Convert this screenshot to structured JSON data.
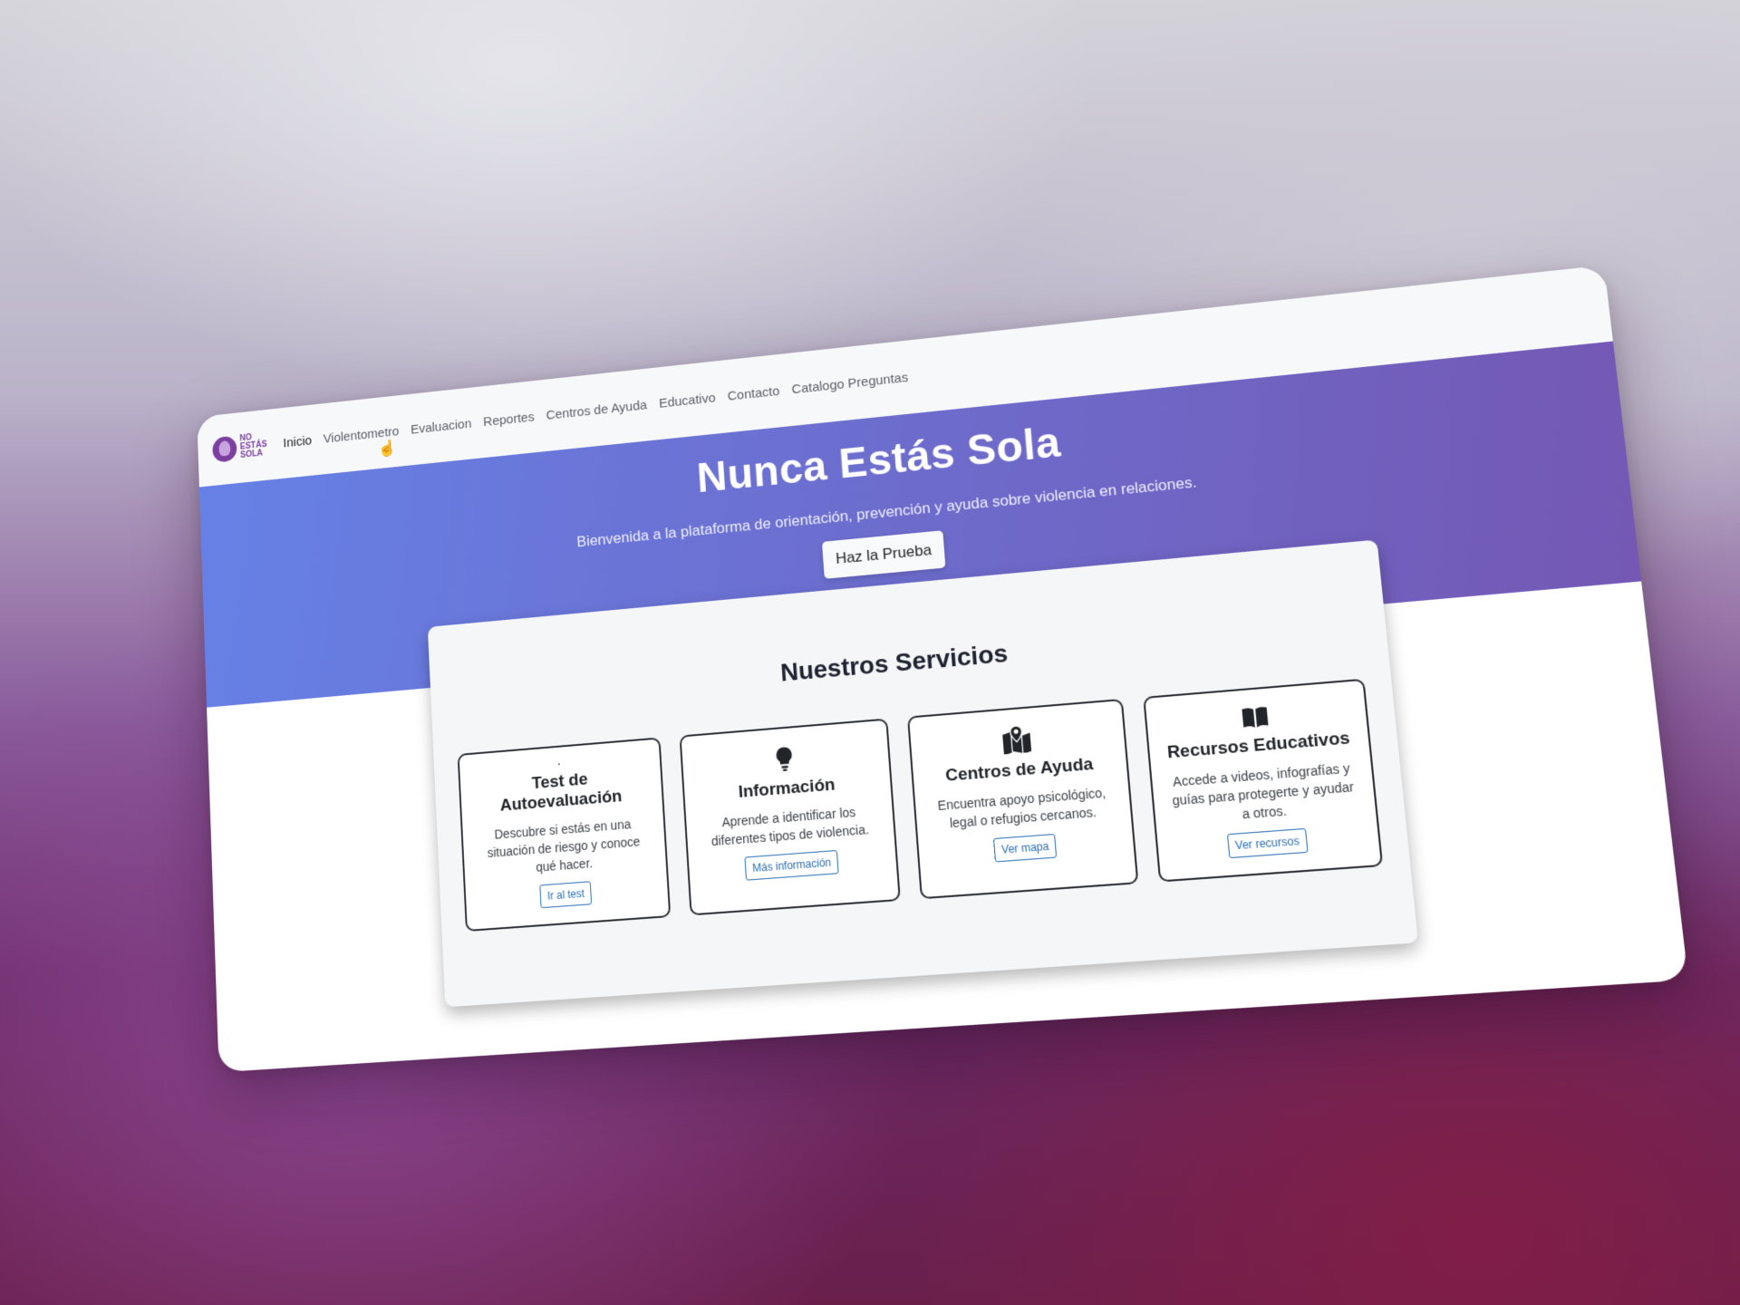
{
  "brand": {
    "logo_lines": [
      "NO",
      "ESTÁS",
      "SOLA"
    ],
    "logo_color": "#7b3fa0"
  },
  "nav": {
    "items": [
      {
        "label": "Inicio",
        "active": true
      },
      {
        "label": "Violentometro",
        "active": false
      },
      {
        "label": "Evaluacion",
        "active": false
      },
      {
        "label": "Reportes",
        "active": false
      },
      {
        "label": "Centros de Ayuda",
        "active": false
      },
      {
        "label": "Educativo",
        "active": false
      },
      {
        "label": "Contacto",
        "active": false
      },
      {
        "label": "Catalogo Preguntas",
        "active": false
      }
    ]
  },
  "hero": {
    "title": "Nunca Estás Sola",
    "subtitle": "Bienvenida a la plataforma de orientación, prevención y ayuda sobre violencia en relaciones.",
    "cta_label": "Haz la Prueba",
    "gradient_start": "#6681e6",
    "gradient_end": "#7458b4"
  },
  "services": {
    "title": "Nuestros Servicios",
    "cards": [
      {
        "icon": "broken-heart-icon",
        "title": "Test de Autoevaluación",
        "text": "Descubre si estás en una situación de riesgo y conoce qué hacer.",
        "button": "Ir al test"
      },
      {
        "icon": "lightbulb-icon",
        "title": "Información",
        "text": "Aprende a identificar los diferentes tipos de violencia.",
        "button": "Más información"
      },
      {
        "icon": "map-pin-icon",
        "title": "Centros de Ayuda",
        "text": "Encuentra apoyo psicológico, legal o refugios cercanos.",
        "button": "Ver mapa"
      },
      {
        "icon": "open-book-icon",
        "title": "Recursos Educativos",
        "text": "Accede a videos, infografías y guías para protegerte y ayudar a otros.",
        "button": "Ver recursos"
      }
    ]
  },
  "colors": {
    "button_outline": "#2a6fb5",
    "card_border": "#2a2d33"
  }
}
